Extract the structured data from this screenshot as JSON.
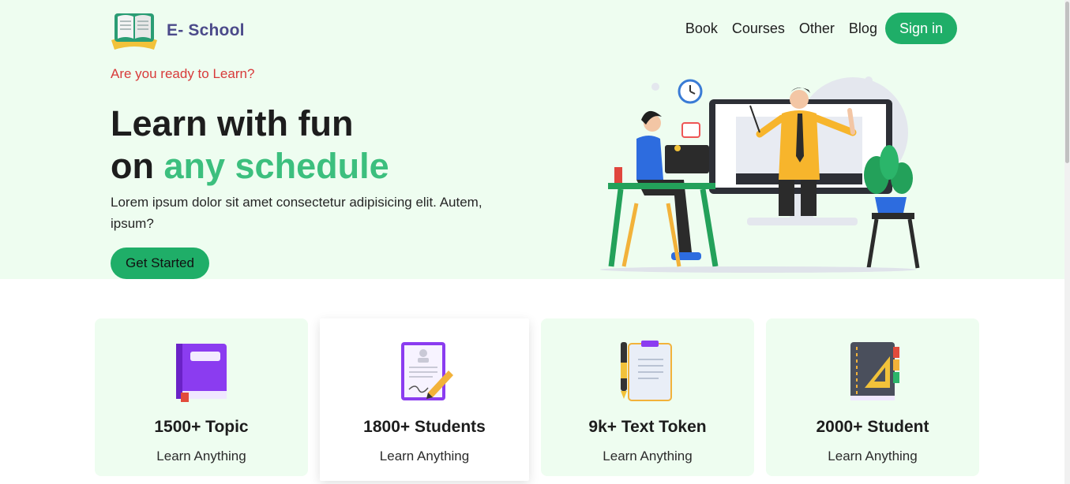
{
  "brand": {
    "name": "E- School",
    "logo_icon": "open-book-icon"
  },
  "nav": {
    "items": [
      "Book",
      "Courses",
      "Other",
      "Blog"
    ],
    "signin": "Sign in"
  },
  "hero": {
    "tagline": "Are you ready to Learn?",
    "title_line1": "Learn with fun",
    "title_line2_prefix": "on ",
    "title_line2_accent": "any schedule",
    "description": "Lorem ipsum dolor sit amet consectetur adipisicing elit. Autem, ipsum?",
    "cta": "Get Started"
  },
  "stats": [
    {
      "title": "1500+ Topic",
      "subtitle": "Learn Anything",
      "icon": "purple-book-icon"
    },
    {
      "title": "1800+ Students",
      "subtitle": "Learn Anything",
      "icon": "certificate-pen-icon"
    },
    {
      "title": "9k+ Text Token",
      "subtitle": "Learn Anything",
      "icon": "clipboard-pen-icon"
    },
    {
      "title": "2000+ Student",
      "subtitle": "Learn Anything",
      "icon": "notebook-ruler-icon"
    }
  ],
  "colors": {
    "primary": "#1fae68",
    "accent": "#3cbf7e",
    "hero_bg": "#eefdf0",
    "tagline": "#d83a3a",
    "brand": "#4b4a8a"
  }
}
